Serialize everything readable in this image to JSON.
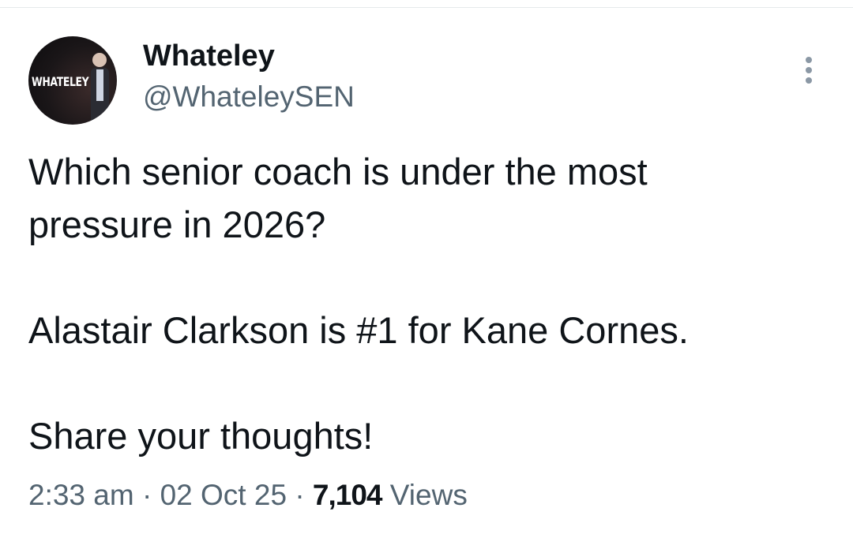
{
  "author": {
    "display_name": "Whateley",
    "handle": "@WhateleySEN",
    "avatar_text": "WHATELEY"
  },
  "tweet": {
    "lines": [
      "Which senior coach is under the most",
      "pressure in 2026?",
      "Alastair Clarkson is #1 for Kane Cornes.",
      "Share your thoughts!"
    ]
  },
  "meta": {
    "time": "2:33 am",
    "separator": "·",
    "date": "02 Oct 25",
    "views_count": "7,104",
    "views_label": "Views"
  },
  "icons": {
    "more": "more-options-icon"
  }
}
